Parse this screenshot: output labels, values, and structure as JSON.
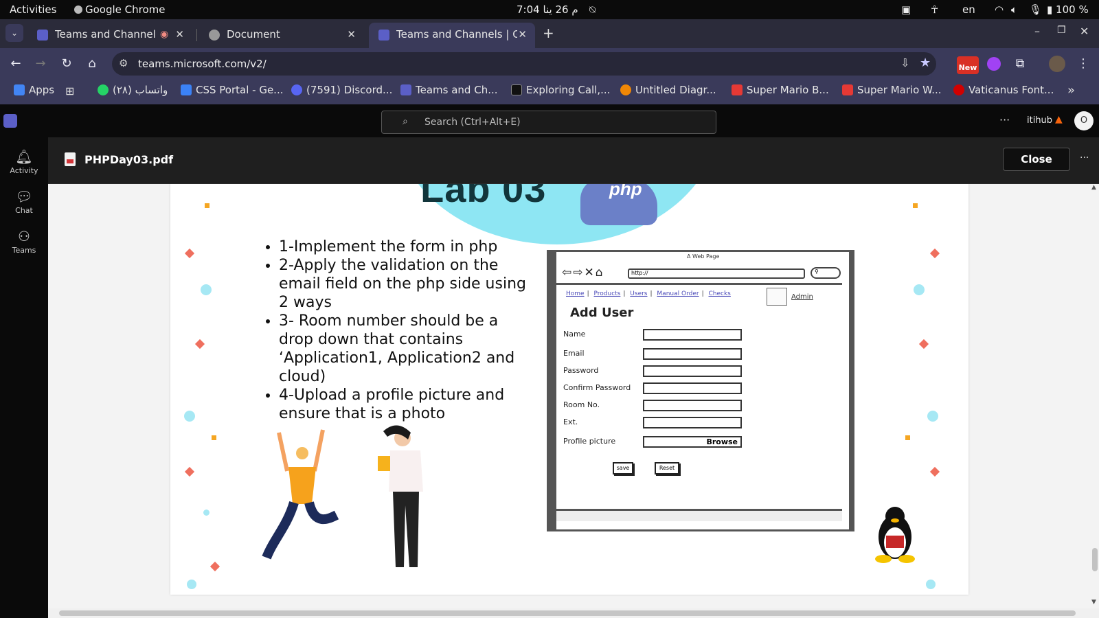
{
  "system_bar": {
    "activities": "Activities",
    "app_name": "Google Chrome",
    "clock": "7:04 م  26 ينا",
    "language": "en",
    "battery": "100 %"
  },
  "browser": {
    "tabs": [
      {
        "label": "Teams and Channels |",
        "active": false
      },
      {
        "label": "Document",
        "active": false
      },
      {
        "label": "Teams and Channels | Ge",
        "active": true
      }
    ],
    "new_tab": "+",
    "url": "teams.microsoft.com/v2/",
    "new_badge": "New",
    "bookmarks": [
      {
        "label": "Apps",
        "color": "#4285f4"
      },
      {
        "label": "واتساب (٢٨)",
        "color": "#25d366"
      },
      {
        "label": "CSS Portal - Ge...",
        "color": "#3b82f6"
      },
      {
        "label": "(7591) Discord...",
        "color": "#5865f2"
      },
      {
        "label": "Teams and Ch...",
        "color": "#5b5fc7"
      },
      {
        "label": "Exploring Call,...",
        "color": "#111111"
      },
      {
        "label": "Untitled Diagr...",
        "color": "#f08705"
      },
      {
        "label": "Super Mario B...",
        "color": "#e53935"
      },
      {
        "label": "Super Mario W...",
        "color": "#e53935"
      },
      {
        "label": "Vaticanus Font...",
        "color": "#d00000"
      }
    ],
    "more": "»"
  },
  "teams": {
    "search_placeholder": "Search (Ctrl+Alt+E)",
    "more": "···",
    "org": "itihub",
    "avatar": "O",
    "rail": [
      {
        "label": "Activity",
        "icon": "bell-icon"
      },
      {
        "label": "Chat",
        "icon": "chat-icon"
      },
      {
        "label": "Teams",
        "icon": "teams-icon"
      }
    ]
  },
  "document": {
    "file_name": "PHPDay03.pdf",
    "close_label": "Close",
    "more": "···"
  },
  "slide": {
    "title": "Lab 03",
    "logo_text": "php",
    "bullets": [
      "1-Implement the form in php",
      "2-Apply the validation on the email field on the php side using 2 ways",
      "3- Room number should be a drop down that contains ‘Application1, Application2 and cloud)",
      "4-Upload a profile picture and ensure that is a photo"
    ],
    "wireframe": {
      "window_title": "A Web Page",
      "address": "http://",
      "nav_links": [
        "Home",
        "Products",
        "Users",
        "Manual Order",
        "Checks"
      ],
      "admin": "Admin",
      "heading": "Add User",
      "fields": [
        "Name",
        "Email",
        "Password",
        "Confirm Password",
        "Room No.",
        "Ext.",
        "Profile picture"
      ],
      "browse": "Browse",
      "save": "save",
      "reset": "Reset"
    }
  }
}
